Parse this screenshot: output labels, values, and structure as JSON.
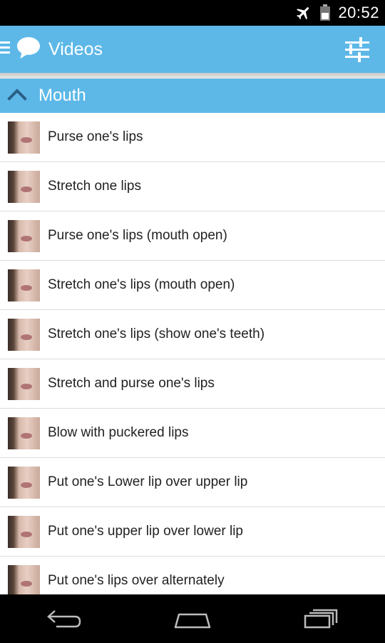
{
  "status_bar": {
    "time": "20:52",
    "icons": [
      "airplane-mode-icon",
      "battery-icon"
    ]
  },
  "action_bar": {
    "title": "Videos",
    "icons": [
      "menu-icon",
      "speech-bubble-icon",
      "settings-sliders-icon"
    ]
  },
  "section": {
    "title": "Mouth",
    "icon": "chevron-up-icon",
    "expanded": true
  },
  "videos": [
    {
      "label": "Purse one's lips"
    },
    {
      "label": "Stretch one lips"
    },
    {
      "label": "Purse one's lips (mouth open)"
    },
    {
      "label": "Stretch one's lips (mouth open)"
    },
    {
      "label": "Stretch one's lips (show one's teeth)"
    },
    {
      "label": "Stretch and purse one's lips"
    },
    {
      "label": "Blow with puckered lips"
    },
    {
      "label": "Put one's Lower lip over upper lip"
    },
    {
      "label": "Put one's upper lip over lower lip"
    },
    {
      "label": "Put one's lips over alternately"
    }
  ],
  "nav_bar": {
    "icons": [
      "back-icon",
      "home-icon",
      "recent-apps-icon"
    ]
  },
  "colors": {
    "accent": "#5db8e8",
    "status_bar": "#000000",
    "list_divider": "#dcdcdc"
  }
}
